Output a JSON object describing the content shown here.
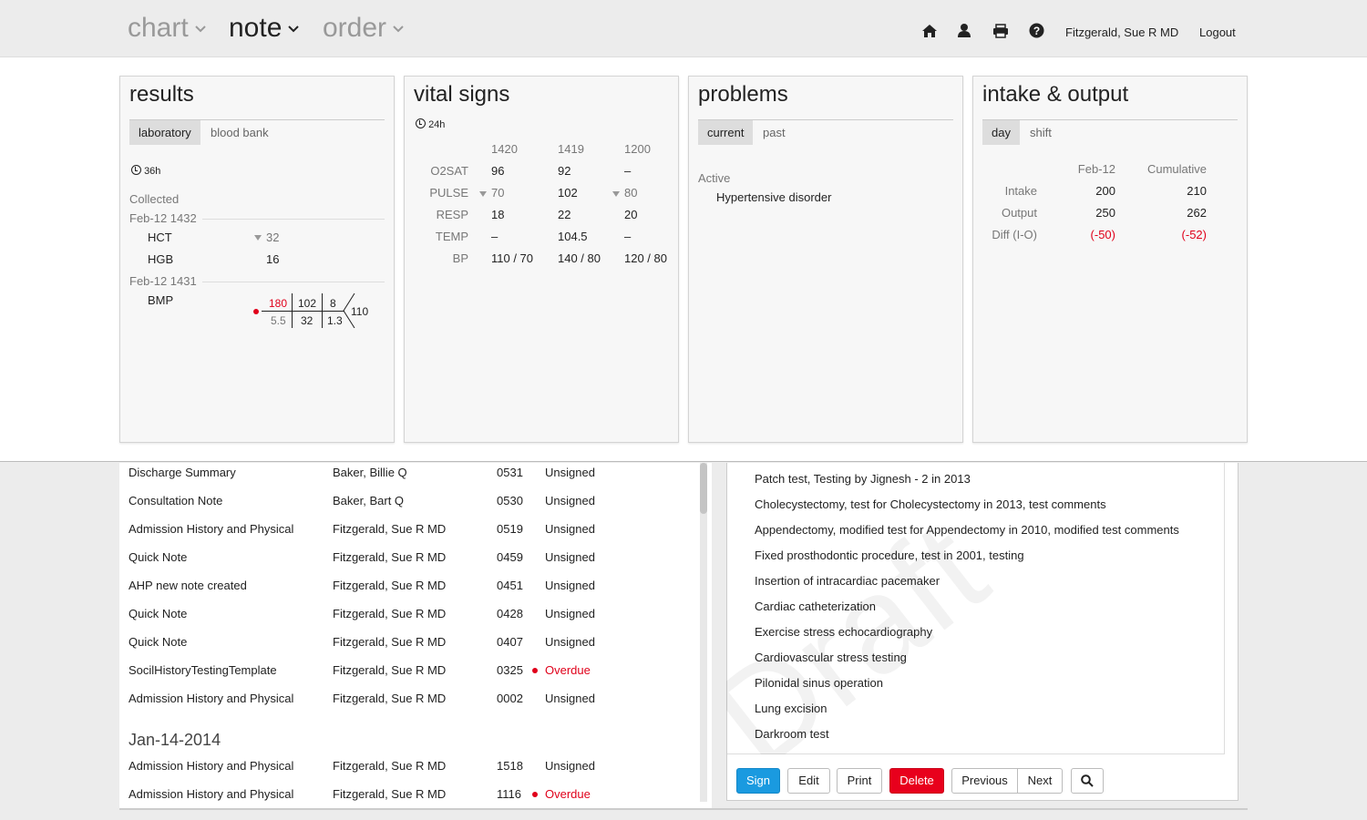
{
  "nav": {
    "menus": [
      {
        "label": "chart",
        "active": false
      },
      {
        "label": "note",
        "active": true
      },
      {
        "label": "order",
        "active": false
      }
    ],
    "icons": [
      "home-icon",
      "user-icon",
      "print-icon",
      "help-icon"
    ],
    "user": "Fitzgerald, Sue R MD",
    "logout": "Logout"
  },
  "results": {
    "title": "results",
    "tabs": [
      "laboratory",
      "blood bank"
    ],
    "active_tab": "laboratory",
    "time_range": "36h",
    "collected_label": "Collected",
    "groups": [
      {
        "datetime": "Feb-12 1432",
        "items": [
          {
            "name": "HCT",
            "value": "32",
            "trend": "down"
          },
          {
            "name": "HGB",
            "value": "16"
          }
        ]
      },
      {
        "datetime": "Feb-12 1431",
        "items": [
          {
            "name": "BMP"
          }
        ]
      }
    ],
    "bmp": {
      "na": "180",
      "cl": "102",
      "bun": "8",
      "k": "5.5",
      "co2": "32",
      "cr": "1.3",
      "glucose": "110",
      "abnormal": true
    }
  },
  "vitals": {
    "title": "vital signs",
    "time_range": "24h",
    "times": [
      "1420",
      "1419",
      "1200"
    ],
    "rows": [
      {
        "label": "O2SAT",
        "values": [
          "96",
          "92",
          "–"
        ]
      },
      {
        "label": "PULSE",
        "values": [
          "70",
          "102",
          "80"
        ],
        "trends": [
          "down",
          "",
          "down"
        ]
      },
      {
        "label": "RESP",
        "values": [
          "18",
          "22",
          "20"
        ]
      },
      {
        "label": "TEMP",
        "values": [
          "–",
          "104.5",
          "–"
        ]
      },
      {
        "label": "BP",
        "values": [
          "110 / 70",
          "140 / 80",
          "120 / 80"
        ]
      }
    ]
  },
  "problems": {
    "title": "problems",
    "tabs": [
      "current",
      "past"
    ],
    "active_tab": "current",
    "section": "Active",
    "items": [
      "Hypertensive disorder"
    ]
  },
  "io": {
    "title": "intake & output",
    "tabs": [
      "day",
      "shift"
    ],
    "active_tab": "day",
    "cols": [
      "Feb-12",
      "Cumulative"
    ],
    "rows": [
      {
        "label": "Intake",
        "values": [
          "200",
          "210"
        ]
      },
      {
        "label": "Output",
        "values": [
          "250",
          "262"
        ]
      },
      {
        "label": "Diff (I-O)",
        "values": [
          "(-50)",
          "(-52)"
        ],
        "negative": true
      }
    ]
  },
  "notes": {
    "rows": [
      {
        "title": "Discharge Summary",
        "author": "Baker, Billie Q",
        "time": "0531",
        "status": "Unsigned"
      },
      {
        "title": "Consultation Note",
        "author": "Baker, Bart Q",
        "time": "0530",
        "status": "Unsigned"
      },
      {
        "title": "Admission History and Physical",
        "author": "Fitzgerald, Sue R MD",
        "time": "0519",
        "status": "Unsigned"
      },
      {
        "title": "Quick Note",
        "author": "Fitzgerald, Sue R MD",
        "time": "0459",
        "status": "Unsigned"
      },
      {
        "title": "AHP new note created",
        "author": "Fitzgerald, Sue R MD",
        "time": "0451",
        "status": "Unsigned"
      },
      {
        "title": "Quick Note",
        "author": "Fitzgerald, Sue R MD",
        "time": "0428",
        "status": "Unsigned"
      },
      {
        "title": "Quick Note",
        "author": "Fitzgerald, Sue R MD",
        "time": "0407",
        "status": "Unsigned"
      },
      {
        "title": "SocilHistoryTestingTemplate",
        "author": "Fitzgerald, Sue R MD",
        "time": "0325",
        "status": "Overdue"
      },
      {
        "title": "Admission History and Physical",
        "author": "Fitzgerald, Sue R MD",
        "time": "0002",
        "status": "Unsigned"
      }
    ],
    "date_header": "Jan-14-2014",
    "rows2": [
      {
        "title": "Admission History and Physical",
        "author": "Fitzgerald, Sue R MD",
        "time": "1518",
        "status": "Unsigned"
      },
      {
        "title": "Admission History and Physical",
        "author": "Fitzgerald, Sue R MD",
        "time": "1116",
        "status": "Overdue"
      }
    ]
  },
  "document": {
    "watermark": "Draft",
    "lines": [
      "Patch test, Testing by Jignesh - 2 in 2013",
      "Cholecystectomy, test for Cholecystectomy in 2013, test comments",
      "Appendectomy, modified test for Appendectomy in 2010, modified test comments",
      "Fixed prosthodontic procedure, test in 2001, testing",
      "Insertion of intracardiac pacemaker",
      "Cardiac catheterization",
      "Exercise stress echocardiography",
      "Cardiovascular stress testing",
      "Pilonidal sinus operation",
      "Lung excision",
      "Darkroom test"
    ]
  },
  "actions": {
    "sign": "Sign",
    "edit": "Edit",
    "print": "Print",
    "delete": "Delete",
    "previous": "Previous",
    "next": "Next"
  },
  "colors": {
    "accent": "#1a9ae0",
    "danger": "#e8001c",
    "abnormal": "#e0001a"
  }
}
